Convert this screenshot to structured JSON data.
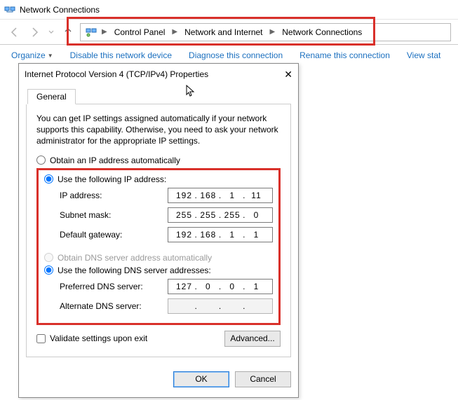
{
  "explorer": {
    "title": "Network Connections",
    "breadcrumbs": [
      "Control Panel",
      "Network and Internet",
      "Network Connections"
    ]
  },
  "toolbar": {
    "organize": "Organize",
    "disable": "Disable this network device",
    "diagnose": "Diagnose this connection",
    "rename": "Rename this connection",
    "view": "View stat"
  },
  "dialog": {
    "title": "Internet Protocol Version 4 (TCP/IPv4) Properties",
    "tab": "General",
    "desc": "You can get IP settings assigned automatically if your network supports this capability. Otherwise, you need to ask your network administrator for the appropriate IP settings.",
    "r_auto_ip": "Obtain an IP address automatically",
    "r_use_ip": "Use the following IP address:",
    "lbl_ip": "IP address:",
    "lbl_mask": "Subnet mask:",
    "lbl_gw": "Default gateway:",
    "r_auto_dns": "Obtain DNS server address automatically",
    "r_use_dns": "Use the following DNS server addresses:",
    "lbl_pdns": "Preferred DNS server:",
    "lbl_adns": "Alternate DNS server:",
    "validate": "Validate settings upon exit",
    "advanced": "Advanced...",
    "ok": "OK",
    "cancel": "Cancel",
    "ip": {
      "a": "192",
      "b": "168",
      "c": "1",
      "d": "11"
    },
    "mask": {
      "a": "255",
      "b": "255",
      "c": "255",
      "d": "0"
    },
    "gw": {
      "a": "192",
      "b": "168",
      "c": "1",
      "d": "1"
    },
    "pdns": {
      "a": "127",
      "b": "0",
      "c": "0",
      "d": "1"
    },
    "adns": {
      "a": "",
      "b": "",
      "c": "",
      "d": ""
    }
  }
}
